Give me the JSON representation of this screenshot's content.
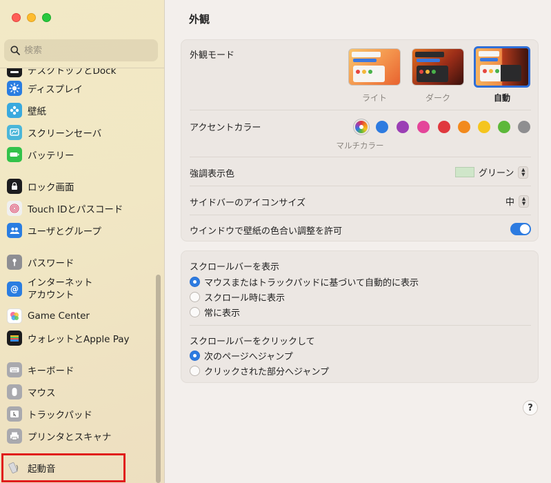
{
  "sidebar": {
    "search_placeholder": "検索",
    "items": [
      {
        "label": "デスクトップとDock",
        "icon": "dock-icon",
        "color": "#1c1c1e"
      },
      {
        "label": "ディスプレイ",
        "icon": "display-brightness-icon",
        "color": "#2a7de1"
      },
      {
        "label": "壁紙",
        "icon": "wallpaper-flower-icon",
        "color": "#39a9de"
      },
      {
        "label": "スクリーンセーバ",
        "icon": "screensaver-icon",
        "color": "#4bb6d9"
      },
      {
        "label": "バッテリー",
        "icon": "battery-icon",
        "color": "#33c24a"
      },
      {
        "label": "ロック画面",
        "icon": "lock-icon",
        "color": "#1c1c1e"
      },
      {
        "label": "Touch IDとパスコード",
        "icon": "fingerprint-icon",
        "color": "#f0f0f0"
      },
      {
        "label": "ユーザとグループ",
        "icon": "users-icon",
        "color": "#2a7de1"
      },
      {
        "label": "パスワード",
        "icon": "key-icon",
        "color": "#8e8e93"
      },
      {
        "label": "インターネット\nアカウント",
        "icon": "at-sign-icon",
        "color": "#2a7de1"
      },
      {
        "label": "Game Center",
        "icon": "game-center-icon",
        "color": "#ffffff"
      },
      {
        "label": "ウォレットとApple Pay",
        "icon": "wallet-icon",
        "color": "#1c1c1e"
      },
      {
        "label": "キーボード",
        "icon": "keyboard-icon",
        "color": "#a9a9ae"
      },
      {
        "label": "マウス",
        "icon": "mouse-icon",
        "color": "#a9a9ae"
      },
      {
        "label": "トラックパッド",
        "icon": "trackpad-icon",
        "color": "#a9a9ae"
      },
      {
        "label": "プリンタとスキャナ",
        "icon": "printer-icon",
        "color": "#a9a9ae"
      },
      {
        "label": "起動音",
        "icon": "startup-sound-icon",
        "color": "#e8e8ea"
      }
    ]
  },
  "main": {
    "title": "外観",
    "appearance": {
      "label": "外観モード",
      "options": [
        {
          "caption": "ライト",
          "selected": false
        },
        {
          "caption": "ダーク",
          "selected": false
        },
        {
          "caption": "自動",
          "selected": true
        }
      ]
    },
    "accent": {
      "label": "アクセントカラー",
      "caption": "マルチカラー",
      "colors": [
        "multicolor",
        "#2d7be0",
        "#9b3fb5",
        "#e4459a",
        "#e0383e",
        "#f28a1d",
        "#f5c51e",
        "#5cb83a",
        "#8e8e90"
      ],
      "selected_index": 0
    },
    "highlight": {
      "label": "強調表示色",
      "value": "グリーン",
      "swatch": "#cfe6c9"
    },
    "sidebar_icon_size": {
      "label": "サイドバーのアイコンサイズ",
      "value": "中"
    },
    "wallpaper_tint": {
      "label": "ウインドウで壁紙の色合い調整を許可",
      "on": true
    },
    "scrollbars": {
      "label": "スクロールバーを表示",
      "options": [
        {
          "label": "マウスまたはトラックパッドに基づいて自動的に表示",
          "selected": true
        },
        {
          "label": "スクロール時に表示",
          "selected": false
        },
        {
          "label": "常に表示",
          "selected": false
        }
      ]
    },
    "click_scrollbar": {
      "label": "スクロールバーをクリックして",
      "options": [
        {
          "label": "次のページへジャンプ",
          "selected": true
        },
        {
          "label": "クリックされた部分へジャンプ",
          "selected": false
        }
      ]
    },
    "help": "?"
  },
  "colors": {
    "accent": "#2d7be0",
    "highlight_box": "#e01b1b"
  }
}
